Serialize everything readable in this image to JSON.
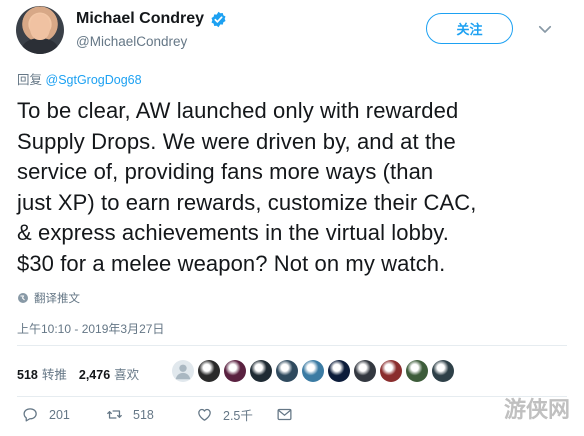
{
  "author": {
    "display_name": "Michael Condrey",
    "handle": "@MichaelCondrey",
    "verified": true
  },
  "follow_label": "关注",
  "reply_to": {
    "prefix": "回复",
    "mention": "@SgtGrogDog68"
  },
  "tweet_lines": [
    "To be clear, AW launched only with rewarded",
    "Supply Drops. We were driven by, and at the",
    "service of, providing fans more ways (than",
    "just XP) to earn rewards, customize their CAC,",
    "& express achievements in the virtual lobby.",
    "$30 for a melee weapon? Not on my watch."
  ],
  "translate_label": "翻译推文",
  "timestamp": "上午10:10 - 2019年3月27日",
  "stats": {
    "retweets_count": "518",
    "retweets_label": "转推",
    "likes_count": "2,476",
    "likes_label": "喜欢"
  },
  "actions": {
    "replies": "201",
    "retweets": "518",
    "likes": "2.5千"
  },
  "watermark": "游侠网",
  "colors": {
    "accent": "#1da1f2",
    "text": "#14171a",
    "muted": "#657786"
  },
  "liker_avatars": [
    {
      "icon": "default-avatar",
      "color": "#aab8c2"
    },
    {
      "icon": "avatar",
      "color": "#2a2a2a"
    },
    {
      "icon": "avatar",
      "color": "#5a2140"
    },
    {
      "icon": "avatar",
      "color": "#1e2a33"
    },
    {
      "icon": "avatar",
      "color": "#2f4a5e"
    },
    {
      "icon": "avatar",
      "color": "#3b7ba3"
    },
    {
      "icon": "avatar",
      "color": "#0c1c3a"
    },
    {
      "icon": "avatar",
      "color": "#333840"
    },
    {
      "icon": "avatar",
      "color": "#8a2d2d"
    },
    {
      "icon": "avatar",
      "color": "#3d5c3a"
    },
    {
      "icon": "avatar",
      "color": "#2e4048"
    }
  ]
}
